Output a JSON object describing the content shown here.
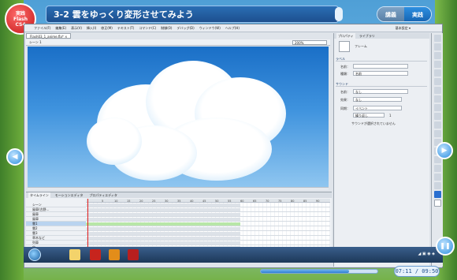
{
  "header": {
    "logo_line1": "実践",
    "logo_line2": "Flash",
    "logo_line3": "CS4",
    "lesson_title": "3-2 雲をゆっくり変形させてみよう",
    "tab_lecture": "講義",
    "tab_practice": "実践"
  },
  "app": {
    "menu": [
      "ファイル(F)",
      "編集(E)",
      "表示(V)",
      "挿入(I)",
      "修正(M)",
      "テキスト(T)",
      "コマンド(C)",
      "制御(O)",
      "デバッグ(D)",
      "ウィンドウ(W)",
      "ヘルプ(H)"
    ],
    "workspace_label": "基本設定 ▾",
    "doc_tab": "Flash03_1_anime.fla* ×",
    "scene": "シーン 1",
    "zoom": "200%"
  },
  "properties": {
    "tab_properties": "プロパティ",
    "tab_library": "ライブラリ",
    "frame_label": "フレーム",
    "section_label": "ラベル",
    "name_label": "名前：",
    "type_label": "種類：",
    "type_value": "名前",
    "section_sound": "サウンド",
    "sound_name_label": "名前：",
    "sound_name_value": "なし",
    "effect_label": "効果：",
    "effect_value": "なし",
    "sync_label": "同期：",
    "sync_value": "イベント",
    "repeat_value": "繰り返し",
    "repeat_count": "1",
    "sound_status": "サウンドが選択されていません"
  },
  "timeline": {
    "tab_timeline": "タイムライン",
    "tab_motion_editor": "モーションエディタ",
    "tab_output": "プロパティエディタ",
    "ruler": [
      "5",
      "10",
      "15",
      "20",
      "25",
      "30",
      "35",
      "40",
      "45",
      "50",
      "55",
      "60",
      "65",
      "70",
      "75",
      "80",
      "85",
      "90"
    ],
    "layers": [
      {
        "name": "シーン"
      },
      {
        "name": "風車(古野…"
      },
      {
        "name": "風車"
      },
      {
        "name": "風車"
      },
      {
        "name": "雲1",
        "selected": true
      },
      {
        "name": "雲2"
      },
      {
        "name": "雲3"
      },
      {
        "name": "草木など"
      },
      {
        "name": "列車"
      },
      {
        "name": "空"
      }
    ],
    "footer": "1  24.0fps  0.0s"
  },
  "player": {
    "time": "07:11 / 09:50",
    "progress": 0.76
  }
}
